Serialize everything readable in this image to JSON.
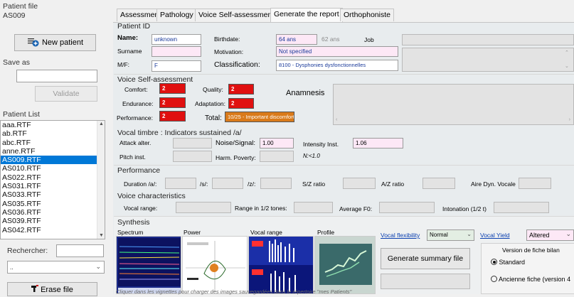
{
  "patient_file": {
    "label": "Patient file",
    "value": "AS009"
  },
  "new_patient": "New patient",
  "save_as": {
    "label": "Save as",
    "value": ""
  },
  "validate": "Validate",
  "patient_list": {
    "label": "Patient List",
    "items": [
      "aaa.RTF",
      "ab.RTF",
      "abc.RTF",
      "anne.RTF",
      "AS009.RTF",
      "AS010.RTF",
      "AS022.RTF",
      "AS031.RTF",
      "AS033.RTF",
      "AS035.RTF",
      "AS036.RTF",
      "AS039.RTF",
      "AS042.RTF"
    ],
    "selected": 4
  },
  "search": {
    "label": "Rechercher:",
    "value": ""
  },
  "combo": {
    "value": ".."
  },
  "erase_file": "Erase file",
  "tabs": [
    "Assessment",
    "Pathology",
    "Voice Self-assessment",
    "Generate the report",
    "Orthophoniste"
  ],
  "active_tab": 3,
  "patient_id": {
    "section": "Patient ID",
    "name_label": "Name:",
    "name_value": "unknown",
    "surname_label": "Surname",
    "surname_value": "",
    "mf_label": "M/F:",
    "mf_value": "F",
    "birthdate_label": "Birthdate:",
    "birthdate_value": "64 ans",
    "age_grey": "62 ans",
    "motivation_label": "Motivation:",
    "motivation_value": "Not specified",
    "classification_label": "Classification:",
    "classification_value": "8100 - Dysphonies dysfonctionnelles",
    "job_label": "Job",
    "job_value": ""
  },
  "voice_self": {
    "section": "Voice Self-assessment",
    "comfort_label": "Comfort:",
    "comfort": "2",
    "quality_label": "Quality:",
    "quality": "2",
    "endurance_label": "Endurance:",
    "endurance": "2",
    "adaptation_label": "Adaptation:",
    "adaptation": "2",
    "performance_label": "Performance:",
    "performance": "2",
    "total_label": "Total:",
    "total": "10/25 - Important discomfort",
    "anamnesis_label": "Anamnesis"
  },
  "vocal_timbre": {
    "section": "Vocal timbre : Indicators sustained /a/",
    "attack_label": "Attack alter.",
    "noise_label": "Noise/Signal:",
    "noise_value": "1.00",
    "intensity_label": "Intensity Inst.",
    "intensity_value": "1.06",
    "pitch_label": "Pitch inst.",
    "harm_label": "Harm. Poverty:",
    "harm_note": "N:<1.0"
  },
  "performance": {
    "section": "Performance",
    "duration_label": "Duration /a/:",
    "s_label": "/s/:",
    "z_label": "/z/:",
    "sz_label": "S/Z ratio",
    "az_label": "A/Z ratio",
    "aire_label": "Aire Dyn. Vocale"
  },
  "voice_char": {
    "section": "Voice characteristics",
    "vocal_range_label": "Vocal range:",
    "range_tones_label": "Range in 1/2 tones:",
    "average_f0_label": "Average F0:",
    "intonation_label": "Intonation (1/2 t)"
  },
  "synthesis": {
    "section": "Synthesis",
    "thumb_titles": [
      "Spectrum",
      "Power",
      "Vocal range",
      "Profile"
    ],
    "footer_note": "Cliquer dans les vignettes pour charger des images sauvegardées dans le répertoire \"mes Patients\"",
    "vocal_flex_label": "Vocal flexibility",
    "vocal_flex_value": "Normal",
    "vocal_yield_label": "Vocal Yield",
    "vocal_yield_value": "Altered",
    "generate_button": "Generate summary file",
    "version_title": "Version de fiche bilan",
    "version_options": [
      "Standard",
      "Ancienne fiche (version 4"
    ],
    "version_selected": 0
  },
  "colors": {
    "selection": "#0078d7",
    "red_field": "#e01010",
    "total_field": "#d97a1a",
    "pink_field": "#fde8f6",
    "link": "#0a3fb0"
  }
}
